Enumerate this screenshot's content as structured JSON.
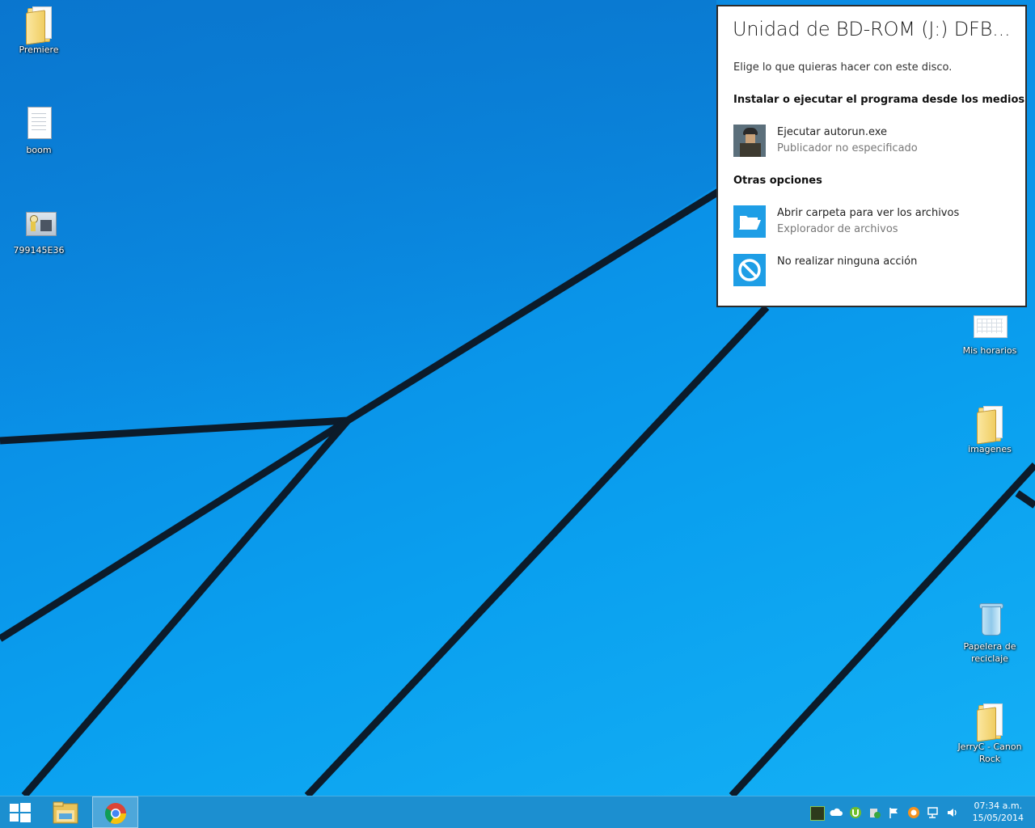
{
  "desktop": {
    "icons_left": [
      {
        "label": "Premiere",
        "kind": "folder"
      },
      {
        "label": "boom",
        "kind": "document"
      },
      {
        "label": "799145E36",
        "kind": "image"
      }
    ],
    "icons_right": [
      {
        "label": "Mis horarios",
        "kind": "sheet"
      },
      {
        "label": "imagenes",
        "kind": "folder"
      },
      {
        "label": "Papelera de reciclaje",
        "kind": "recycle-bin"
      },
      {
        "label": "JerryC - Canon Rock",
        "kind": "folder"
      }
    ]
  },
  "autoplay": {
    "title": "Unidad de BD-ROM (J:) DFB...",
    "subtitle": "Elige lo que quieras hacer con este disco.",
    "section_install": "Instalar o ejecutar el programa desde los medios",
    "run_main": "Ejecutar autorun.exe",
    "run_sub": "Publicador no especificado",
    "section_other": "Otras opciones",
    "open_main": "Abrir carpeta para ver los archivos",
    "open_sub": "Explorador de archivos",
    "none_main": "No realizar ninguna acción",
    "accent": "#1e9ee6"
  },
  "taskbar": {
    "apps": [
      "start-button",
      "file-explorer",
      "google-chrome"
    ],
    "tray_icons": [
      "nvidia-icon",
      "onedrive-icon",
      "utorrent-icon",
      "security-icon",
      "action-center-flag-icon",
      "avast-icon",
      "network-icon",
      "volume-icon"
    ],
    "clock_time": "07:34 a.m.",
    "clock_date": "15/05/2014",
    "color": "#1c8fd0"
  }
}
